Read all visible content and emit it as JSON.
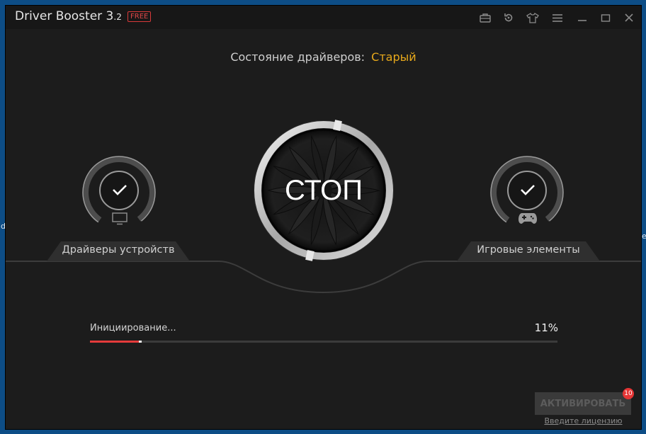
{
  "desktop": {
    "left_fragment": "d",
    "right_fragment": "e"
  },
  "window": {
    "title": "Driver Booster 3",
    "version_suffix": ".2",
    "badge": "FREE",
    "toolbar_icons": [
      "toolbox-icon",
      "restore-history-icon",
      "skin-shirt-icon",
      "menu-icon",
      "minimize-icon",
      "maximize-icon",
      "close-icon"
    ]
  },
  "status": {
    "label": "Состояние драйверов:",
    "value": "Старый",
    "value_color": "#e8a91b"
  },
  "main_button": {
    "label": "СТОП"
  },
  "left_panel": {
    "label": "Драйверы устройств",
    "icon": "monitor-icon",
    "state": "check-icon"
  },
  "right_panel": {
    "label": "Игровые элементы",
    "icon": "gamepad-icon",
    "state": "check-icon"
  },
  "progress": {
    "label": "Инициирование...",
    "percent_text": "11%",
    "value": 0.11,
    "accent_color": "#e53b3b"
  },
  "footer": {
    "activate_label": "АКТИВИРОВАТЬ",
    "notification_count": "10",
    "license_link": "Введите лицензию"
  }
}
